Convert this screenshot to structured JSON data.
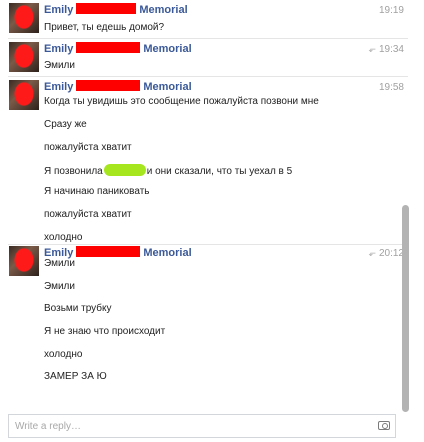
{
  "thread": {
    "groups": [
      {
        "name_first": "Emily",
        "name_last": "Memorial",
        "time": "19:19",
        "show_reply_icon": false,
        "messages": [
          "Привет, ты едешь домой?"
        ]
      },
      {
        "name_first": "Emily",
        "name_last": "Memorial",
        "time": "19:34",
        "show_reply_icon": true,
        "messages": [
          "Эмили"
        ]
      },
      {
        "name_first": "Emily",
        "name_last": "Memorial",
        "time": "19:58",
        "show_reply_icon": false,
        "messages": [
          "Когда ты увидишь это сообщение пожалуйста позвони мне",
          "Сразу же",
          "пожалуйста хватит",
          "Я позвонила",
          "Я начинаю паниковать",
          "пожалуйста хватит",
          "холодно"
        ],
        "message_3_suffix": "и они сказали, что ты уехал в 5"
      },
      {
        "name_first": "Emily",
        "name_last": "Memorial",
        "time": "20:12",
        "show_reply_icon": true,
        "messages": [
          "Эмили",
          "Эмили",
          "Возьми трубку",
          "Я не знаю что происходит",
          "холодно",
          "ЗАМЕР ЗА Ю"
        ]
      }
    ]
  },
  "composer": {
    "placeholder": "Write a reply…"
  },
  "icons": {
    "reply": "reply-icon",
    "camera": "camera-icon"
  }
}
